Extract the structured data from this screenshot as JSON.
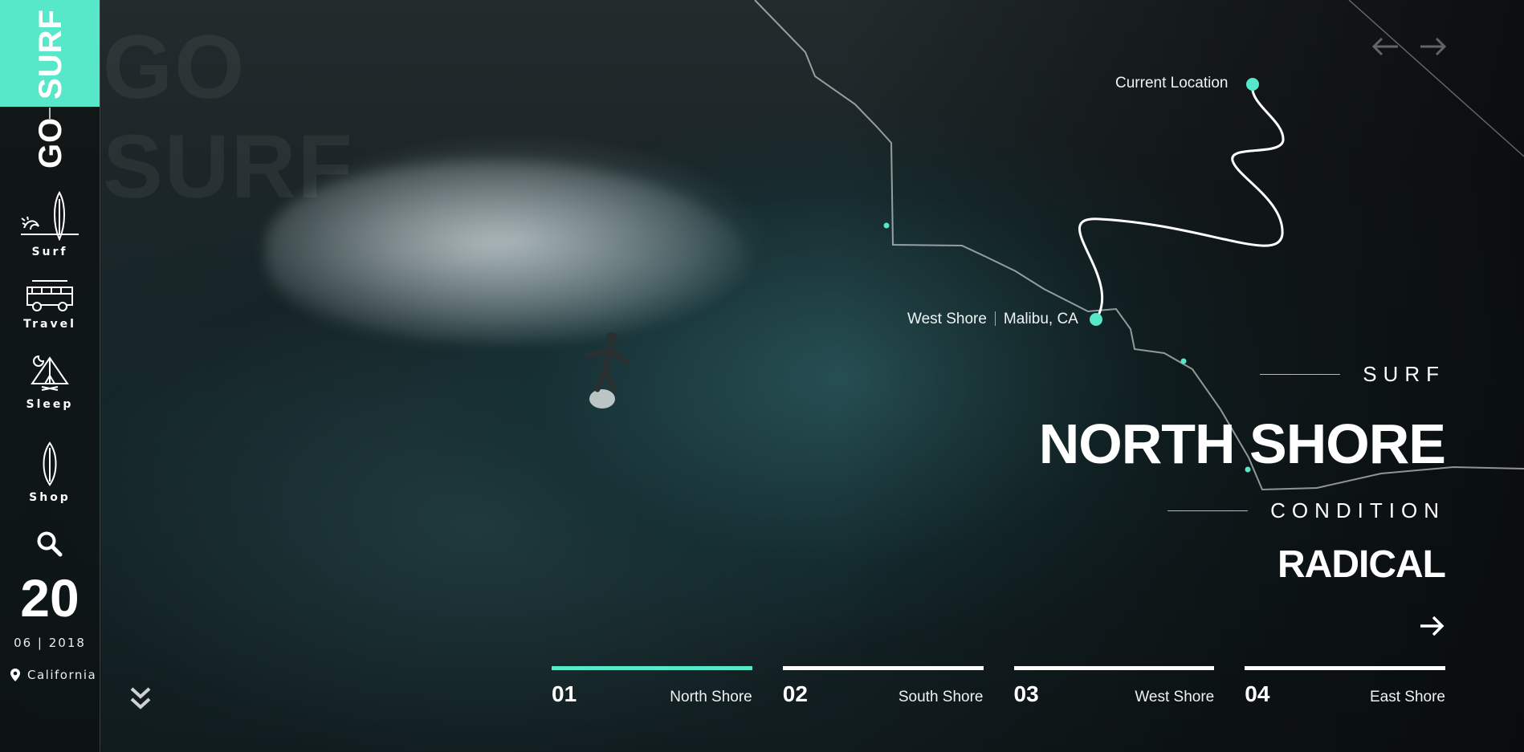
{
  "brand": {
    "logo_top": "SURF",
    "logo_bottom": "GO",
    "bg_word_1": "GO",
    "bg_word_2": "SURF"
  },
  "sidebar": {
    "items": [
      {
        "label": "Surf",
        "icon": "surfboard-wave-icon"
      },
      {
        "label": "Travel",
        "icon": "van-icon"
      },
      {
        "label": "Sleep",
        "icon": "tent-campfire-icon"
      },
      {
        "label": "Shop",
        "icon": "board-icon"
      }
    ],
    "search_icon": "search-icon",
    "date": {
      "day": "20",
      "month_year": "06 | 2018"
    },
    "location": "California"
  },
  "map": {
    "current_location": "Current Location",
    "spot_name": "West Shore",
    "spot_city": "Malibu, CA"
  },
  "hero": {
    "eyebrow": "SURF",
    "title": "NORTH SHORE",
    "condition_label": "CONDITION",
    "condition_value": "RADICAL"
  },
  "slides": [
    {
      "num": "01",
      "name": "North Shore",
      "active": true
    },
    {
      "num": "02",
      "name": "South Shore",
      "active": false
    },
    {
      "num": "03",
      "name": "West Shore",
      "active": false
    },
    {
      "num": "04",
      "name": "East Shore",
      "active": false
    }
  ],
  "colors": {
    "accent": "#56e8c8",
    "text": "#ffffff",
    "background": "#0f1516"
  }
}
